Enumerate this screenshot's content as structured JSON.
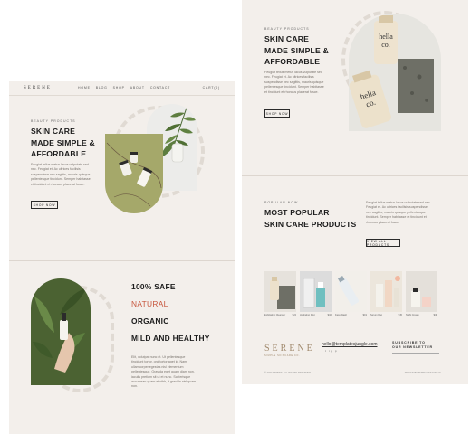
{
  "nav": {
    "logo": "SERENE",
    "links": [
      "HOME",
      "BLOG",
      "SHOP",
      "ABOUT",
      "CONTACT"
    ],
    "cart": "CART(0)"
  },
  "left_hero": {
    "eyebrow": "BEAUTY PRODUCTS",
    "title_line1": "SKIN CARE",
    "title_line2": "MADE SIMPLE &",
    "title_line3": "AFFORDABLE",
    "body": "Feugiat tellus metus lacus vulputate sed nec. Feugiat et. Ac ultrices facilisis suspendisse nec sagittis, mauris quisque pellentesque tincidunt. Semper habitasse et tincidunt et rhoncus placerat fusce.",
    "button": "SHOP NOW"
  },
  "features": {
    "items": [
      "100% SAFE",
      "NATURAL",
      "ORGANIC",
      "MILD AND HEALTHY"
    ],
    "highlight_color": "#c7573e",
    "body": "Elit, volutpat nunc et. Ut pellentesque tincidunt tortor, orci tortor aget id. Nam ullamcorper egestas nisl elementum pellentesque. Gravida eget quam diam non, iaculis pretium sit ut et nunc. Scelerisque accumsan quam et nibh, it gravida nisl quam non."
  },
  "right_hero": {
    "eyebrow": "BEAUTY PRODUCTS",
    "title_line1": "SKIN CARE",
    "title_line2": "MADE SIMPLE &",
    "title_line3": "AFFORDABLE",
    "body": "Feugiat tellus metus lacus vulputate sed nec. Feugiat et. Ac ultrices facilisis suspendisse nec sagittis, mauris quisque pellentesque tincidunt. Semper habitasse et tincidunt et rhoncus placerat fusce.",
    "button": "SHOP NOW",
    "product_label": "hella co."
  },
  "popular": {
    "eyebrow": "POPULAR NOW",
    "title_line1": "MOST POPULAR",
    "title_line2": "SKIN CARE PRODUCTS",
    "body": "Feugiat tellus metus lacus vulputate sed nec. Feugiat et. Ac ultrices facilisis suspendisse nec sagittis, mauris quisque pellentesque tincidunt. Semper habitasse et tincidunt et rhoncus placerat fusce.",
    "button": "VIEW ALL PRODUCTS",
    "products": [
      {
        "name": "Exfoliating Cleanser",
        "price": "$24"
      },
      {
        "name": "Hydrating Mist",
        "price": "$32"
      },
      {
        "name": "Face Wash",
        "price": "$19"
      },
      {
        "name": "Serum Duo",
        "price": "$45"
      },
      {
        "name": "Night Cream",
        "price": "$38"
      }
    ]
  },
  "footer": {
    "logo": "SERENE",
    "tagline": "SIMPLE SKINCARE CO.",
    "email": "hello@templatesjungle.com",
    "social": "f  t  ig  p",
    "subscribe_line1": "SUBSCRIBE TO",
    "subscribe_line2": "OUR NEWSLETTER",
    "copyright": "© 2024 SERENE. ALL RIGHTS RESERVED.",
    "credit": "DESIGN BY TEMPLATESJUNGLE"
  },
  "colors": {
    "page_bg": "#f3efeb",
    "olive": "#a5a86a",
    "accent_red": "#c7573e",
    "dash": "#e0dad3",
    "footer_gold": "#a0896d"
  }
}
